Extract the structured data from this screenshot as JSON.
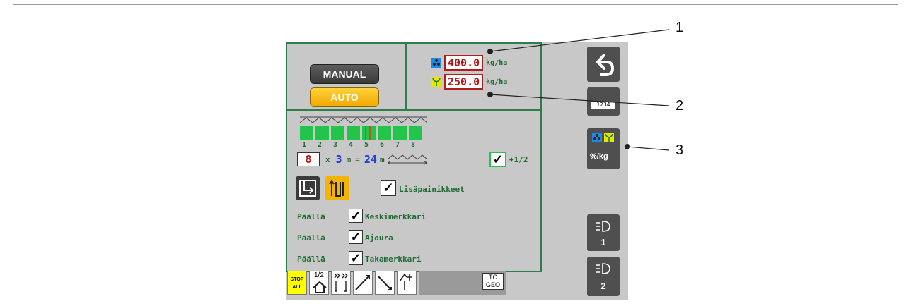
{
  "mode": {
    "manual_label": "MANUAL",
    "auto_label": "AUTO"
  },
  "rates": [
    {
      "value": "400.0",
      "unit": "kg/ha",
      "icon": "fertilizer-icon",
      "color": "#1e88e5"
    },
    {
      "value": "250.0",
      "unit": "kg/ha",
      "icon": "seed-icon",
      "color": "#e6e600"
    }
  ],
  "sections": {
    "numbers": [
      "1",
      "2",
      "3",
      "4",
      "5",
      "6",
      "7",
      "8"
    ],
    "selected": [
      5
    ]
  },
  "width": {
    "count": "8",
    "times": "x",
    "section_width": "3",
    "unit1": "m",
    "equals": "=",
    "total": "24",
    "unit2": "m",
    "half_label": "+1/2"
  },
  "extra_buttons_label": "Lisäpainikkeet",
  "markers": [
    {
      "state": "Päällä",
      "label": "Keskimerkkari"
    },
    {
      "state": "Päällä",
      "label": "Ajoura"
    },
    {
      "state": "Päällä",
      "label": "Takamerkkari"
    }
  ],
  "toolbar": {
    "stop_line1": "STOP",
    "stop_line2": "ALL",
    "half_label": "1/2",
    "tc_line1": "TC",
    "tc_line2": "GEO"
  },
  "side": {
    "units_label": "%/kg",
    "light1_label": "1",
    "light2_label": "2"
  },
  "callouts": [
    "1",
    "2",
    "3"
  ]
}
